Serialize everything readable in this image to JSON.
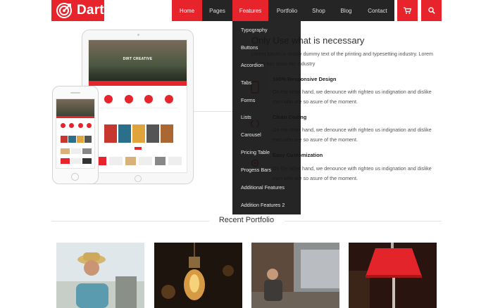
{
  "brand": {
    "name": "Dart",
    "color": "#e7242c"
  },
  "nav": {
    "items": [
      {
        "label": "Home"
      },
      {
        "label": "Pages"
      },
      {
        "label": "Features"
      },
      {
        "label": "Portfolio"
      },
      {
        "label": "Shop"
      },
      {
        "label": "Blog"
      },
      {
        "label": "Contact"
      }
    ],
    "cart_icon": "cart-icon",
    "search_icon": "search-icon"
  },
  "dropdown": {
    "items": [
      {
        "label": "Typography"
      },
      {
        "label": "Buttons"
      },
      {
        "label": "Accordion"
      },
      {
        "label": "Tabs"
      },
      {
        "label": "Forms"
      },
      {
        "label": "Lists"
      },
      {
        "label": "Carousel"
      },
      {
        "label": "Pricing Table"
      },
      {
        "label": "Progess Bars"
      },
      {
        "label": "Additional Features"
      },
      {
        "label": "Addition Features 2"
      }
    ]
  },
  "device_mockup": {
    "hero_title": "DIRT CREATIVE"
  },
  "about": {
    "title": "Only Use what is necessary",
    "intro_line1": "Lorem Ipsum is simply dummy text of the printing and typesetting industry. Lorem",
    "intro_line2": "Ipsum has been the industry",
    "features": [
      {
        "title": "100% Responsive Design",
        "line1": "On the other hand, we denounce with righteo us indignation and dislike",
        "line2": "men who are so asure of the moment."
      },
      {
        "title": "Clean Coding",
        "line1": "On the other hand, we denounce with righteo us indignation and dislike",
        "line2": "men who are so asure of the moment."
      },
      {
        "title": "Easy Customization",
        "line1": "On the other hand, we denounce with righteo us indignation and dislike",
        "line2": "men who are so asure of the moment."
      }
    ]
  },
  "portfolio": {
    "title": "Recent Portfolio"
  }
}
